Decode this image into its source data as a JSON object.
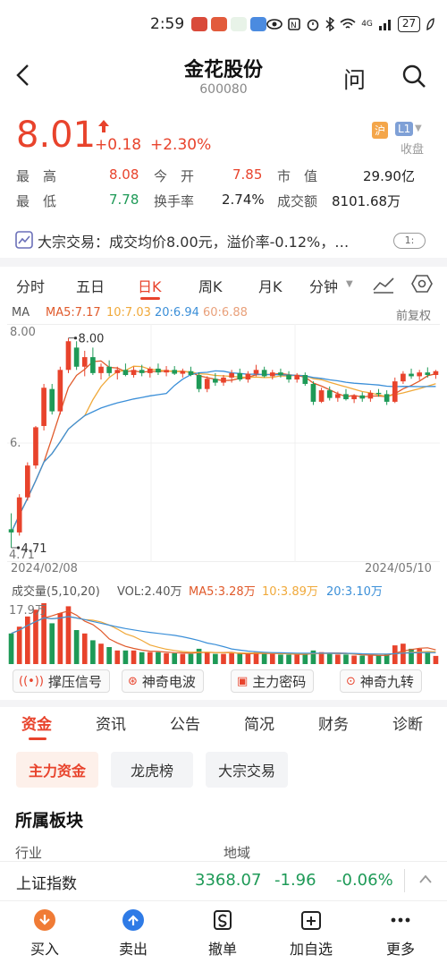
{
  "status_bar": {
    "time": "2:59",
    "signal_text": "4G",
    "battery": "27"
  },
  "header": {
    "stock_name": "金花股份",
    "stock_code": "600080",
    "ask_label": "问"
  },
  "quote": {
    "price": "8.01",
    "change": "+0.18",
    "change_pct": "+2.30%",
    "tag_market": "沪",
    "tag_level": "L1",
    "close_label": "收盘"
  },
  "stats": {
    "high_label": "最　高",
    "high": "8.08",
    "open_label": "今　开",
    "open": "7.85",
    "mktcap_label": "市　值",
    "mktcap": "29.90亿",
    "low_label": "最　低",
    "low": "7.78",
    "turnover_label": "换手率",
    "turnover": "2.74%",
    "amount_label": "成交额",
    "amount": "8101.68万"
  },
  "block_trade": {
    "text": "大宗交易：成交均价8.00元，溢价率-0.12%，…",
    "badge": "1:"
  },
  "period_tabs": [
    "分时",
    "五日",
    "日K",
    "周K",
    "月K",
    "分钟"
  ],
  "period_active": "日K",
  "ma": {
    "label": "MA",
    "ma5": "MA5:7.17",
    "ma10": "10:7.03",
    "ma20": "20:6.94",
    "ma60": "60:6.88",
    "adjust": "前复权"
  },
  "kchart": {
    "top_label": "8.00",
    "high_marker": "8.00",
    "low_marker": "4.71",
    "low_axis": "4.71",
    "mid_axis": "6.",
    "date_start": "2024/02/08",
    "date_end": "2024/05/10"
  },
  "volume": {
    "label": "成交量(5,10,20)",
    "vol": "VOL:2.40万",
    "ma5": "MA5:3.28万",
    "ma10": "10:3.89万",
    "ma20": "20:3.10万",
    "top_label": "17.9万"
  },
  "signals": [
    "撑压信号",
    "神奇电波",
    "主力密码",
    "神奇九转"
  ],
  "info_tabs": [
    "资金",
    "资讯",
    "公告",
    "简况",
    "财务",
    "诊断"
  ],
  "sub_tabs": [
    "主力资金",
    "龙虎榜",
    "大宗交易"
  ],
  "sector": {
    "title": "所属板块",
    "col1": "行业",
    "col2": "地域"
  },
  "index_bar": {
    "name": "上证指数",
    "value": "3368.07",
    "change": "-1.96",
    "pct": "-0.06%"
  },
  "bottom_bar": [
    "买入",
    "卖出",
    "撤单",
    "加自选",
    "更多"
  ],
  "colors": {
    "up": "#e8432c",
    "down": "#1e9a57",
    "ma5": "#e05a2b",
    "ma10": "#f0a93a",
    "ma20": "#3b8fd8",
    "ma60": "#e9a07a"
  },
  "chart_data": {
    "type": "candlestick",
    "ylim": [
      4.71,
      8.08
    ],
    "candles": [
      [
        5.0,
        5.25,
        4.71,
        4.95
      ],
      [
        4.95,
        5.55,
        4.9,
        5.5
      ],
      [
        5.5,
        6.05,
        5.45,
        6.0
      ],
      [
        6.0,
        6.62,
        5.95,
        6.6
      ],
      [
        6.62,
        7.28,
        6.55,
        7.22
      ],
      [
        7.2,
        7.28,
        6.8,
        6.85
      ],
      [
        6.85,
        7.55,
        6.8,
        7.5
      ],
      [
        7.5,
        8.0,
        7.45,
        7.95
      ],
      [
        7.85,
        7.95,
        7.5,
        7.55
      ],
      [
        7.55,
        7.8,
        7.4,
        7.7
      ],
      [
        7.7,
        7.85,
        7.42,
        7.45
      ],
      [
        7.45,
        7.6,
        7.35,
        7.55
      ],
      [
        7.55,
        7.65,
        7.4,
        7.45
      ],
      [
        7.45,
        7.55,
        7.35,
        7.5
      ],
      [
        7.5,
        7.6,
        7.4,
        7.42
      ],
      [
        7.42,
        7.55,
        7.38,
        7.5
      ],
      [
        7.5,
        7.58,
        7.4,
        7.45
      ],
      [
        7.45,
        7.55,
        7.38,
        7.52
      ],
      [
        7.52,
        7.6,
        7.42,
        7.46
      ],
      [
        7.46,
        7.56,
        7.4,
        7.5
      ],
      [
        7.5,
        7.56,
        7.42,
        7.44
      ],
      [
        7.44,
        7.52,
        7.38,
        7.48
      ],
      [
        7.48,
        7.55,
        7.4,
        7.42
      ],
      [
        7.42,
        7.46,
        7.15,
        7.2
      ],
      [
        7.2,
        7.4,
        7.15,
        7.36
      ],
      [
        7.36,
        7.45,
        7.25,
        7.3
      ],
      [
        7.3,
        7.42,
        7.25,
        7.38
      ],
      [
        7.38,
        7.5,
        7.3,
        7.45
      ],
      [
        7.45,
        7.52,
        7.32,
        7.35
      ],
      [
        7.35,
        7.48,
        7.3,
        7.44
      ],
      [
        7.44,
        7.58,
        7.4,
        7.5
      ],
      [
        7.5,
        7.55,
        7.38,
        7.4
      ],
      [
        7.4,
        7.5,
        7.35,
        7.46
      ],
      [
        7.46,
        7.52,
        7.38,
        7.42
      ],
      [
        7.42,
        7.48,
        7.3,
        7.35
      ],
      [
        7.35,
        7.45,
        7.3,
        7.42
      ],
      [
        7.42,
        7.46,
        7.25,
        7.28
      ],
      [
        7.28,
        7.32,
        6.95,
        7.0
      ],
      [
        7.0,
        7.22,
        6.98,
        7.18
      ],
      [
        7.18,
        7.24,
        7.02,
        7.06
      ],
      [
        7.06,
        7.16,
        7.0,
        7.12
      ],
      [
        7.12,
        7.2,
        7.02,
        7.04
      ],
      [
        7.04,
        7.12,
        6.98,
        7.1
      ],
      [
        7.1,
        7.15,
        7.0,
        7.05
      ],
      [
        7.05,
        7.18,
        7.0,
        7.14
      ],
      [
        7.14,
        7.2,
        7.08,
        7.12
      ],
      [
        7.12,
        7.18,
        6.95,
        7.0
      ],
      [
        7.0,
        7.38,
        6.98,
        7.32
      ],
      [
        7.32,
        7.48,
        7.28,
        7.44
      ],
      [
        7.44,
        7.52,
        7.36,
        7.4
      ],
      [
        7.4,
        7.5,
        7.34,
        7.46
      ],
      [
        7.46,
        7.54,
        7.38,
        7.42
      ],
      [
        7.42,
        7.5,
        7.36,
        7.48
      ]
    ],
    "volumes": [
      9,
      11,
      14,
      16,
      17.9,
      12,
      15,
      17,
      10,
      9,
      7,
      6,
      5,
      4,
      4,
      4,
      3.5,
      3.5,
      3.5,
      3.2,
      3.2,
      3,
      3,
      4.5,
      3.5,
      3,
      3,
      3.2,
      3,
      3,
      3.5,
      3,
      3,
      2.8,
      2.8,
      2.8,
      3,
      4,
      3.5,
      3,
      2.8,
      2.8,
      2.5,
      2.5,
      2.5,
      2.5,
      2.8,
      5.5,
      6,
      4.5,
      4.5,
      3.5,
      2.4
    ]
  }
}
